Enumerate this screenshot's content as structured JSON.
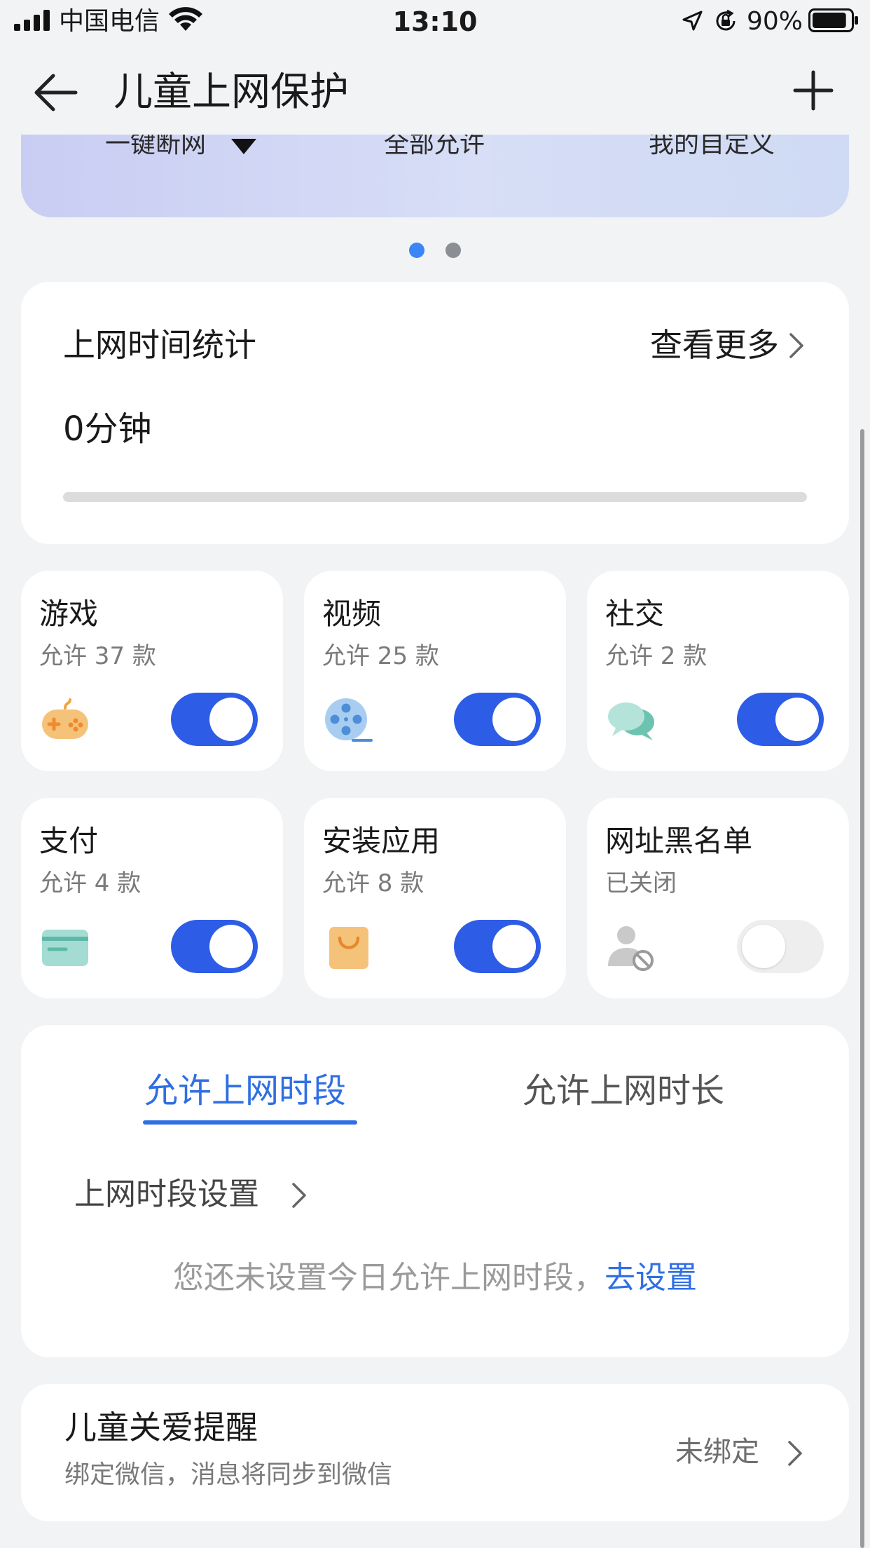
{
  "status_bar": {
    "carrier": "中国电信",
    "time": "13:10",
    "battery_percent": "90%",
    "battery_level": 0.9
  },
  "header": {
    "title": "儿童上网保护"
  },
  "banner": {
    "options": [
      "一键断网",
      "全部允许",
      "我的自定义"
    ],
    "page_count": 2,
    "active_page": 1
  },
  "usage": {
    "title": "上网时间统计",
    "more_label": "查看更多",
    "value": "0分钟",
    "progress_percent": 0
  },
  "categories": [
    {
      "name": "游戏",
      "status": "允许 37 款",
      "icon": "gamepad-icon",
      "enabled": true
    },
    {
      "name": "视频",
      "status": "允许 25 款",
      "icon": "film-reel-icon",
      "enabled": true
    },
    {
      "name": "社交",
      "status": "允许 2 款",
      "icon": "chat-bubbles-icon",
      "enabled": true
    },
    {
      "name": "支付",
      "status": "允许 4 款",
      "icon": "credit-card-icon",
      "enabled": true
    },
    {
      "name": "安装应用",
      "status": "允许 8 款",
      "icon": "shopping-bag-icon",
      "enabled": true
    },
    {
      "name": "网址黑名单",
      "status": "已关闭",
      "icon": "blocked-user-icon",
      "enabled": false
    }
  ],
  "schedule": {
    "tabs": [
      "允许上网时段",
      "允许上网时长"
    ],
    "active_tab": 0,
    "setting_label": "上网时段设置",
    "hint_text": "您还未设置今日允许上网时段，",
    "hint_link": "去设置"
  },
  "reminder": {
    "title": "儿童关爱提醒",
    "subtitle": "绑定微信，消息将同步到微信",
    "status": "未绑定"
  },
  "colors": {
    "accent": "#2d5ce6",
    "link": "#2f6fe4",
    "background": "#f1f3f5",
    "dot_active": "#3a86f7",
    "dot_inactive": "#8b8f94"
  }
}
